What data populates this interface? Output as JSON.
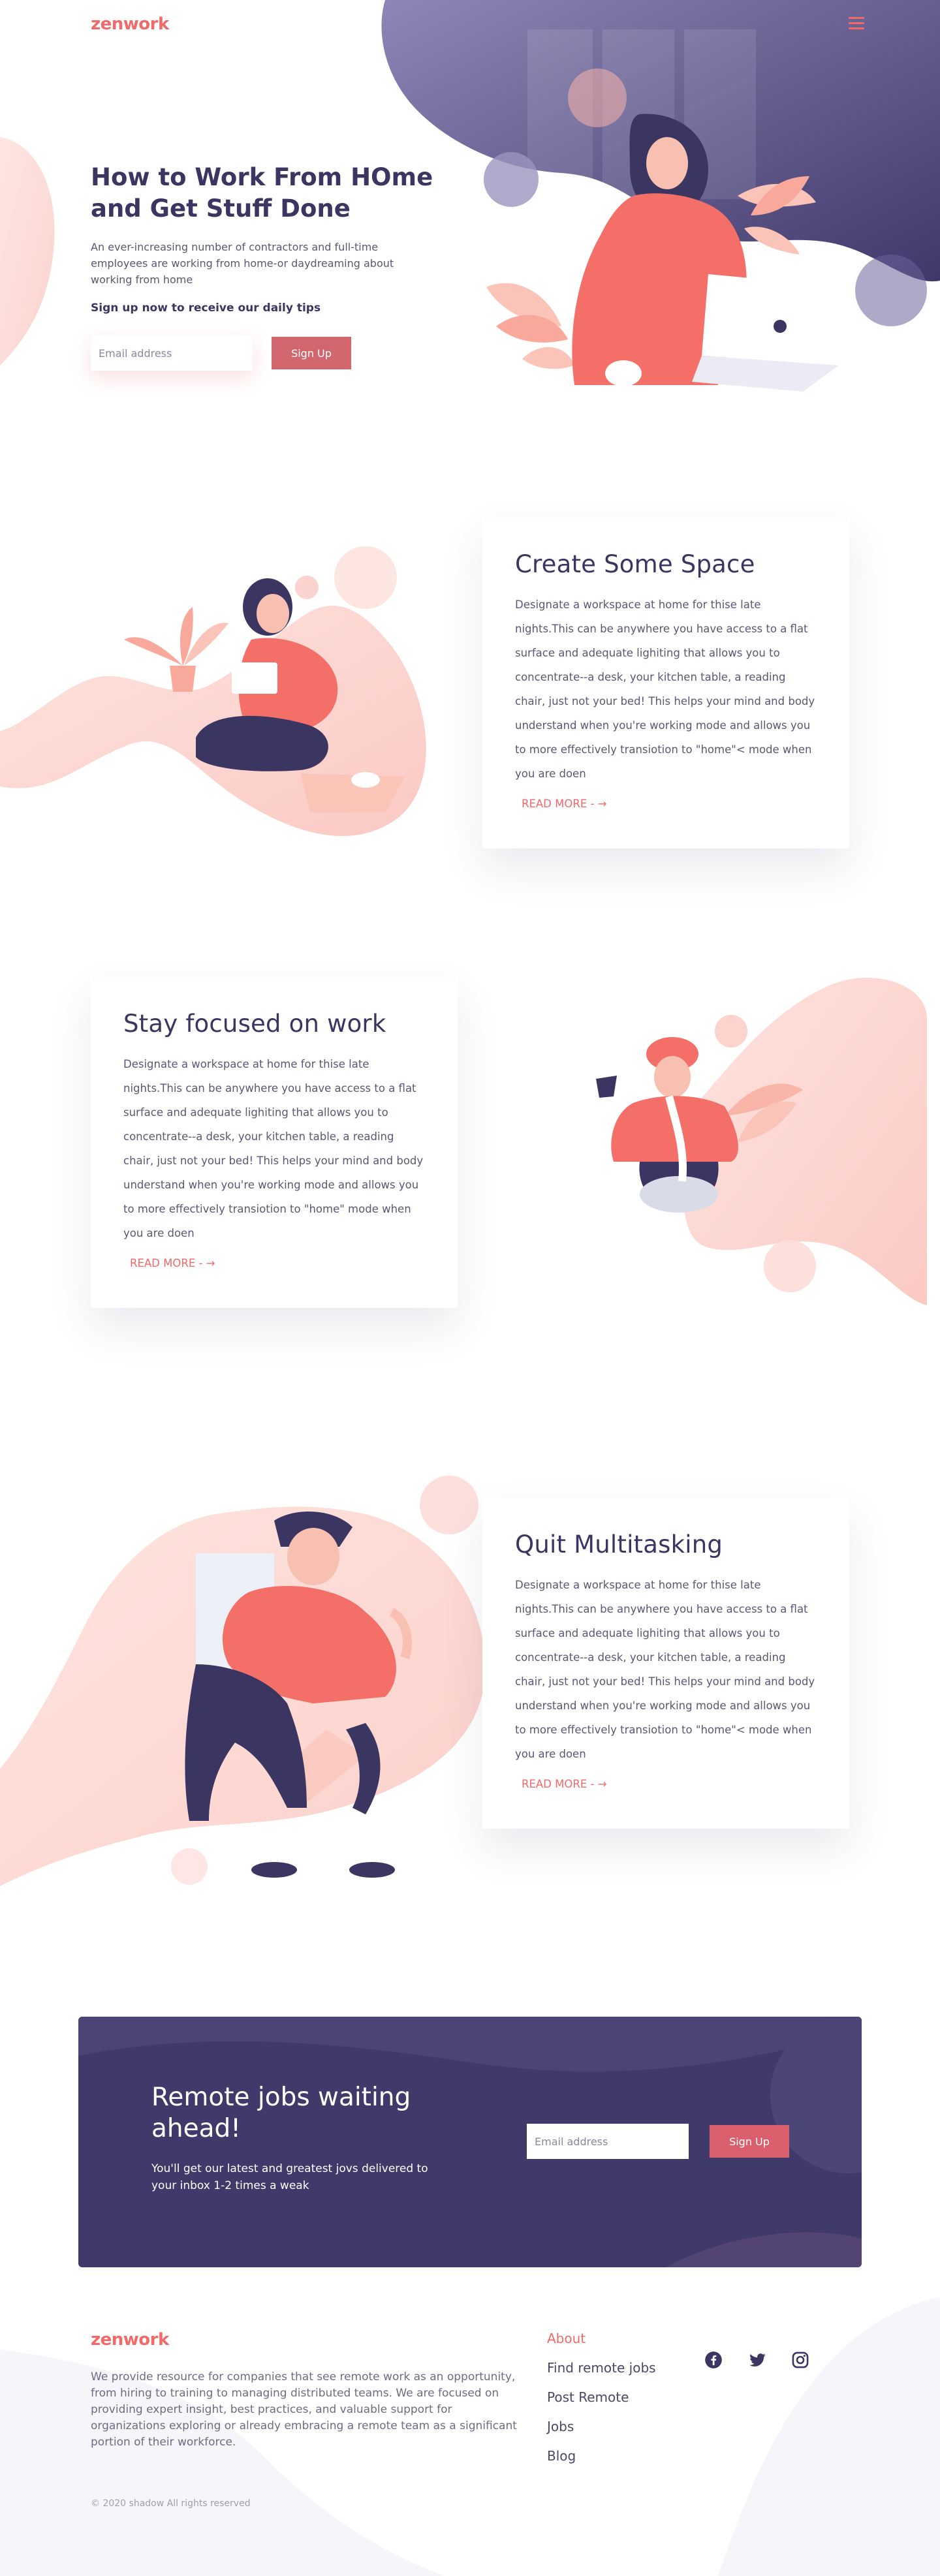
{
  "header": {
    "logo": "zenwork",
    "menu_icon": "hamburger-menu-icon"
  },
  "hero": {
    "title": "How to Work From HOme and Get Stuff Done",
    "description": "An ever-increasing number of contractors and full-time employees are working from home-or daydreaming about working from home",
    "cta_label": "Sign up now to receive our daily tips",
    "email_placeholder": "Email address",
    "signup_button": "Sign Up"
  },
  "features": [
    {
      "title": "Create Some Space",
      "body": "Designate a workspace at home for thise late nights.This can be anywhere you have access to a flat surface and adequate lighiting that allows you to concentrate--a desk, your kitchen table, a reading chair, just not your bed! This helps your mind and body understand when you're working mode and allows you to more effectively transiotion to \"home\"< mode when you are doen",
      "read_more": "READ MORE - →"
    },
    {
      "title": "Stay focused on work",
      "body": "Designate a workspace at home for thise late nights.This can be anywhere you have access to a flat surface and adequate lighiting that allows you to concentrate--a desk, your kitchen table, a reading chair, just not your bed! This helps your mind and body understand when you're working mode and allows you to more effectively transiotion to \"home\" mode when you are doen",
      "read_more": "READ MORE - →"
    },
    {
      "title": "Quit Multitasking",
      "body": "Designate a workspace at home for thise late nights.This can be anywhere you have access to a flat surface and adequate lighiting that allows you to concentrate--a desk, your kitchen table, a reading chair, just not your bed! This helps your mind and body understand when you're working mode and allows you to more effectively transiotion to \"home\"< mode when you are doen",
      "read_more": "READ MORE - →"
    }
  ],
  "newsletter": {
    "title": "Remote jobs waiting ahead!",
    "description": "You'll get our latest and greatest jovs delivered to your inbox 1-2 times a weak",
    "email_placeholder": "Email address",
    "signup_button": "Sign Up"
  },
  "footer": {
    "logo": "zenwork",
    "description": "We provide resource for companies that see remote work as an opportunity, from hiring to training to managing distributed teams. We are focused on providing expert insight, best practices, and valuable support for organizations exploring or already embracing a remote team as a significant portion of their workforce.",
    "links": [
      "About",
      "Find remote jobs",
      "Post Remote",
      "Jobs",
      "Blog"
    ],
    "social_icons": [
      "facebook-icon",
      "twitter-icon",
      "instagram-icon"
    ],
    "copyright": "© 2020 shadow All rights reserved"
  },
  "colors": {
    "brand_coral": "#f06a6a",
    "brand_purple": "#403a6b",
    "text_dark": "#3b3561",
    "button_hero": "#d2666e"
  }
}
